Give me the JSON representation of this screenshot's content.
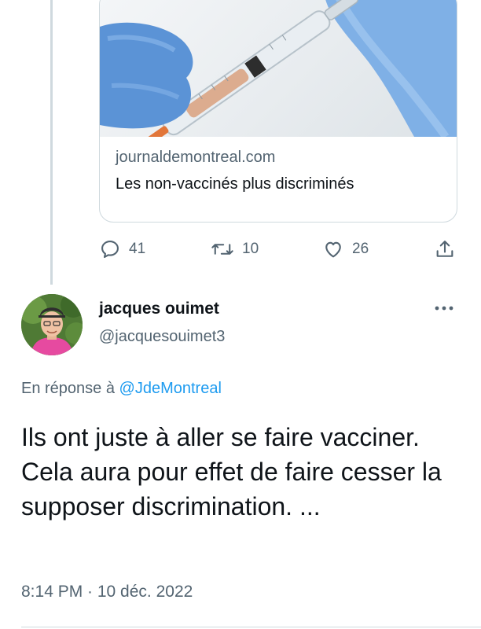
{
  "link_card": {
    "domain": "journaldemontreal.com",
    "title": "Les non-vaccinés plus discriminés",
    "image_icon": "syringe-and-gloved-hands-photo"
  },
  "actions": {
    "reply_count": "41",
    "retweet_count": "10",
    "like_count": "26",
    "icons": [
      "reply-icon",
      "retweet-icon",
      "like-icon",
      "share-icon"
    ]
  },
  "reply": {
    "author_name": "jacques ouimet",
    "author_handle": "@jacquesouimet3",
    "reply_prefix": "En réponse à",
    "reply_mention": "@JdeMontreal",
    "text": "Ils ont juste à aller se faire vacciner. Cela aura pour effet de faire cesser la supposer discrimination. ...",
    "timestamp": "8:14 PM · 10 déc. 2022"
  },
  "colors": {
    "secondary_text": "#536471",
    "link": "#1d9bf0",
    "border": "#cfd9de"
  }
}
